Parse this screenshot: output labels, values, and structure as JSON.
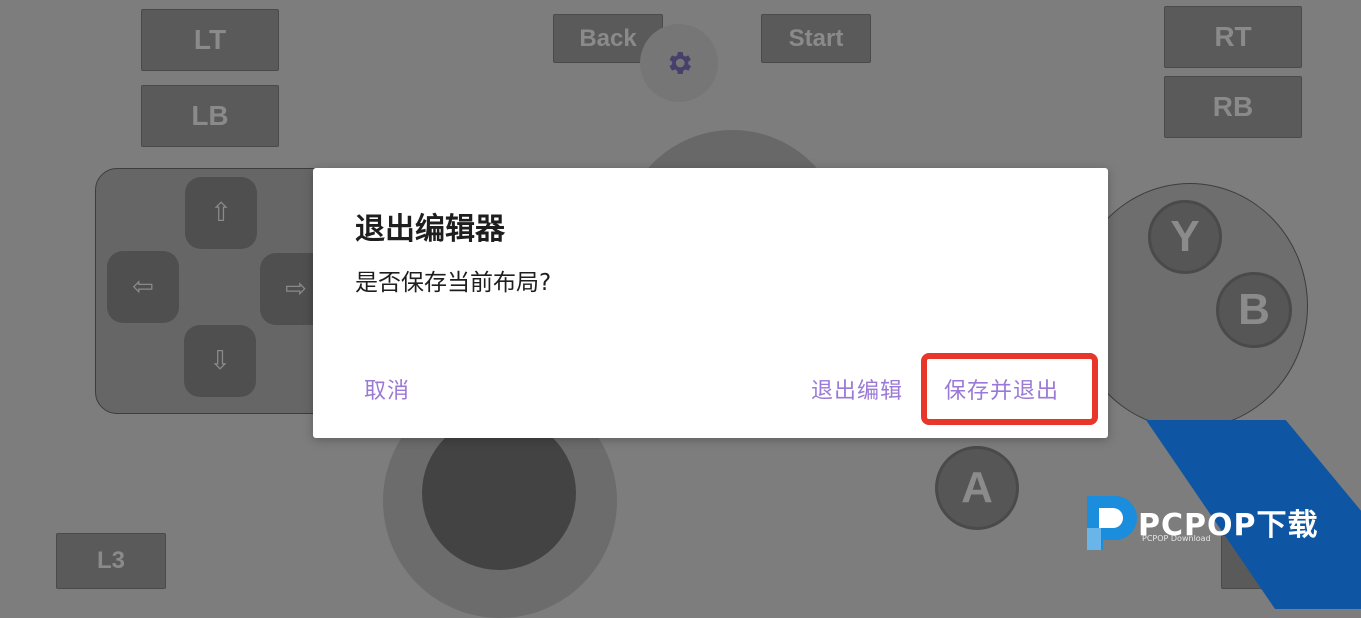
{
  "controller": {
    "lt": "LT",
    "lb": "LB",
    "back": "Back",
    "start": "Start",
    "rt": "RT",
    "rb": "RB",
    "l3": "L3",
    "y": "Y",
    "b": "B",
    "a": "A",
    "dpad": {
      "up": "⇧",
      "down": "⇩",
      "left": "⇦",
      "right": "⇨"
    },
    "settings_icon": "gear-icon"
  },
  "dialog": {
    "title": "退出编辑器",
    "message": "是否保存当前布局?",
    "cancel": "取消",
    "exit_edit": "退出编辑",
    "save_exit": "保存并退出"
  },
  "watermark": {
    "brand": "PCPOP下载",
    "sub": "PCPOP Download"
  },
  "colors": {
    "accent": "#9a7ad6",
    "highlight": "#e8372a",
    "watermark_blue": "#0e56a3"
  }
}
